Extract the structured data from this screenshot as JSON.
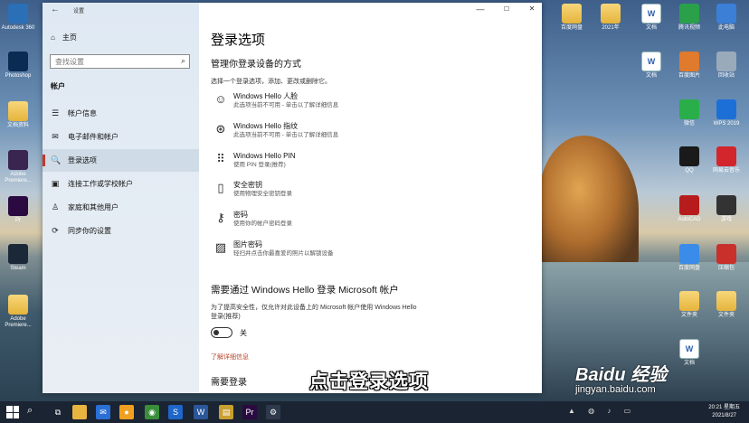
{
  "desktop": {
    "left_icons": [
      {
        "label": "Autodesk 360",
        "icon": "autodesk-icon",
        "color": "#2b6fb6"
      },
      {
        "label": "Photoshop",
        "icon": "photoshop-icon",
        "color": "#0b2c52"
      },
      {
        "label": "文档资料",
        "icon": "folder-icon",
        "color": "#e5b43c"
      },
      {
        "label": "Adobe Premiere...",
        "icon": "adobe-icon",
        "color": "#3a2450"
      },
      {
        "label": "Pr",
        "icon": "premiere-icon",
        "color": "#2a0a40"
      },
      {
        "label": "Steam",
        "icon": "steam-icon",
        "color": "#1b2838"
      },
      {
        "label": "Adobe Premiere...",
        "icon": "folder-icon",
        "color": "#e5b43c"
      }
    ],
    "right_icons": [
      {
        "label": "百度网盘",
        "icon": "folder-icon",
        "color": "#e5b43c"
      },
      {
        "label": "2021年",
        "icon": "folder-icon",
        "color": "#e5b43c"
      },
      {
        "label": "文档",
        "icon": "doc-icon",
        "color": "#2a5fb0"
      },
      {
        "label": "腾讯视频",
        "icon": "video-icon",
        "color": "#2aa04a"
      },
      {
        "label": "此电脑",
        "icon": "computer-icon",
        "color": "#3b7fd6"
      },
      {
        "label": "文档",
        "icon": "doc-icon",
        "color": "#2a5fb0"
      },
      {
        "label": "百度图片",
        "icon": "image-icon",
        "color": "#e07a2c"
      },
      {
        "label": "回收站",
        "icon": "recycle-bin-icon",
        "color": "#9ab"
      },
      {
        "label": "微信",
        "icon": "wechat-icon",
        "color": "#2aae4a"
      },
      {
        "label": "WPS 2019",
        "icon": "wps-icon",
        "color": "#1d6fd8"
      },
      {
        "label": "QQ",
        "icon": "qq-icon",
        "color": "#1a1a1a"
      },
      {
        "label": "网易云音乐",
        "icon": "music-icon",
        "color": "#d3262c"
      },
      {
        "label": "AutoCAD",
        "icon": "autocad-icon",
        "color": "#b71c1c"
      },
      {
        "label": "游戏",
        "icon": "game-icon",
        "color": "#333"
      },
      {
        "label": "百度网盘",
        "icon": "cloud-icon",
        "color": "#3b8be8"
      },
      {
        "label": "压缩包",
        "icon": "archive-icon",
        "color": "#c9302c"
      },
      {
        "label": "文件夹",
        "icon": "folder-icon",
        "color": "#e5b43c"
      },
      {
        "label": "文件夹",
        "icon": "folder-icon",
        "color": "#e5b43c"
      },
      {
        "label": "文档",
        "icon": "doc-icon",
        "color": "#2a5fb0"
      }
    ]
  },
  "window": {
    "title": "设置",
    "back": "←",
    "minimize": "—",
    "maximize": "☐",
    "close": "✕"
  },
  "nav": {
    "home_label": "主页",
    "search_placeholder": "查找设置",
    "heading": "帐户",
    "items": [
      {
        "label": "帐户信息",
        "icon": "person-icon",
        "glyph": "☰"
      },
      {
        "label": "电子邮件和帐户",
        "icon": "mail-icon",
        "glyph": "✉"
      },
      {
        "label": "登录选项",
        "icon": "key-icon",
        "glyph": "🔍"
      },
      {
        "label": "连接工作或学校帐户",
        "icon": "briefcase-icon",
        "glyph": "▣"
      },
      {
        "label": "家庭和其他用户",
        "icon": "people-icon",
        "glyph": "♙"
      },
      {
        "label": "同步你的设置",
        "icon": "sync-icon",
        "glyph": "⟳"
      }
    ],
    "active_index": 2
  },
  "main": {
    "title": "登录选项",
    "manage_heading": "管理你登录设备的方式",
    "manage_desc": "选择一个登录选项，添加、更改或删除它。",
    "options": [
      {
        "name": "Windows Hello 人脸",
        "desc": "此选项当前不可用 - 单击以了解详细信息",
        "icon": "face-icon",
        "glyph": "☺"
      },
      {
        "name": "Windows Hello 指纹",
        "desc": "此选项当前不可用 - 单击以了解详细信息",
        "icon": "fingerprint-icon",
        "glyph": "⊛"
      },
      {
        "name": "Windows Hello PIN",
        "desc": "使用 PIN 登录(推荐)",
        "icon": "pin-icon",
        "glyph": "⠿"
      },
      {
        "name": "安全密钥",
        "desc": "使用物理安全密钥登录",
        "icon": "usb-key-icon",
        "glyph": "▯"
      },
      {
        "name": "密码",
        "desc": "使用你的帐户密码登录",
        "icon": "password-icon",
        "glyph": "⚷"
      },
      {
        "name": "图片密码",
        "desc": "轻扫并点击你最喜爱的照片以解锁设备",
        "icon": "picture-icon",
        "glyph": "▨"
      }
    ],
    "hello_heading": "需要通过 Windows Hello 登录 Microsoft 帐户",
    "hello_desc": "为了提高安全性，仅允许对此设备上的 Microsoft 帐户使用 Windows Hello 登录(推荐)",
    "toggle_state": "关",
    "toggle_on": false,
    "learn_more": "了解详细信息",
    "need_login_heading": "需要登录"
  },
  "overlay": {
    "caption": "点击登录选项",
    "watermark_logo": "Baidu 经验",
    "watermark_url": "jingyan.baidu.com"
  },
  "taskbar": {
    "search_glyph": "⌕",
    "apps": [
      {
        "icon": "task-view-icon",
        "color": "#1b2432",
        "glyph": "⧉"
      },
      {
        "icon": "file-explorer-icon",
        "color": "#e8b440",
        "glyph": ""
      },
      {
        "icon": "mail-app-icon",
        "color": "#2a6fd6",
        "glyph": "✉"
      },
      {
        "icon": "baidu-netdisk-icon",
        "color": "#f0a020",
        "glyph": "●"
      },
      {
        "icon": "chrome-icon",
        "color": "#3a8e3a",
        "glyph": "◉"
      },
      {
        "icon": "sogou-icon",
        "color": "#1e66c9",
        "glyph": "S"
      },
      {
        "icon": "word-icon",
        "color": "#2b579a",
        "glyph": "W"
      },
      {
        "icon": "explorer-app-icon",
        "color": "#c9a030",
        "glyph": "▤"
      },
      {
        "icon": "premiere-taskbar-icon",
        "color": "#2a0a40",
        "glyph": "Pr"
      },
      {
        "icon": "settings-taskbar-icon",
        "color": "#2e3a4c",
        "glyph": "⚙"
      }
    ],
    "time": "20:21",
    "weekday": "星期五",
    "date": "2021/8/27"
  }
}
